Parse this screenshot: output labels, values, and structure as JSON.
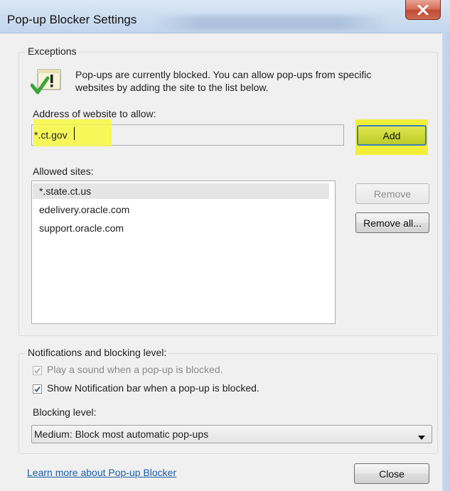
{
  "window": {
    "title": "Pop-up Blocker Settings",
    "close_icon": "close-x-icon"
  },
  "exceptions": {
    "group_label": "Exceptions",
    "info_line1": "Pop-ups are currently blocked.  You can allow pop-ups from specific",
    "info_line2": "websites by adding the site to the list below.",
    "address_label": "Address of website to allow:",
    "address_value": "*.ct.gov",
    "add_label": "Add",
    "allowed_label": "Allowed sites:",
    "allowed_sites": [
      "*.state.ct.us",
      "edelivery.oracle.com",
      "support.oracle.com"
    ],
    "remove_label": "Remove",
    "remove_all_label": "Remove all..."
  },
  "notifications": {
    "group_label": "Notifications and blocking level:",
    "play_sound_label": "Play a sound when a pop-up is blocked.",
    "play_sound_checked": true,
    "show_bar_label": "Show Notification bar when a pop-up is blocked.",
    "show_bar_checked": true,
    "blocking_level_label": "Blocking level:",
    "blocking_level_value": "Medium: Block most automatic pop-ups"
  },
  "footer": {
    "learn_more_label": "Learn more about Pop-up Blocker",
    "close_label": "Close"
  },
  "colors": {
    "highlight": "#f2ef3a",
    "link": "#1a5ea8"
  }
}
